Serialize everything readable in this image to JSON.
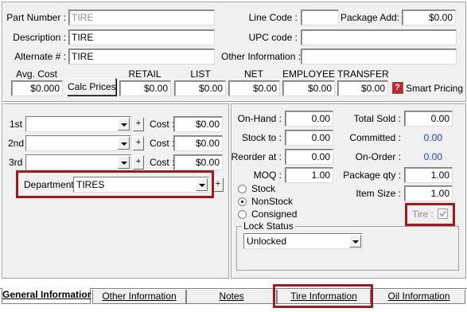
{
  "identity": {
    "part_number_label": "Part Number :",
    "part_number_value": "TIRE",
    "description_label": "Description :",
    "description_value": "TIRE",
    "alternate_label": "Alternate # :",
    "alternate_value": "TIRE",
    "line_code_label": "Line Code :",
    "line_code_value": "",
    "package_add_label": "Package Add:",
    "package_add_value": "$0.00",
    "upc_label": "UPC code :",
    "upc_value": "",
    "other_info_label": "Other Information :",
    "other_info_value": ""
  },
  "prices": {
    "avg_cost_label": "Avg. Cost",
    "avg_cost_value": "$0.000",
    "calc_prices_label": "Calc Prices",
    "retail_label": "RETAIL",
    "retail_value": "$0.00",
    "list_label": "LIST",
    "list_value": "$0.00",
    "net_label": "NET",
    "net_value": "$0.00",
    "employee_label": "EMPLOYEE",
    "employee_value": "$0.00",
    "transfer_label": "TRANSFER",
    "transfer_value": "$0.00",
    "smart_pricing_label": "Smart Pricing",
    "help_glyph": "?"
  },
  "vendors": {
    "rows": [
      {
        "label": "1st",
        "value": "",
        "cost_label": "Cost :",
        "cost_value": "$0.00"
      },
      {
        "label": "2nd",
        "value": "",
        "cost_label": "Cost :",
        "cost_value": "$0.00"
      },
      {
        "label": "3rd",
        "value": "",
        "cost_label": "Cost :",
        "cost_value": "$0.00"
      }
    ],
    "plus_glyph": "+",
    "department_label": "Department :",
    "department_value": "TIRES"
  },
  "stock": {
    "on_hand_label": "On-Hand :",
    "on_hand_value": "0.00",
    "stock_to_label": "Stock to :",
    "stock_to_value": "0.00",
    "reorder_label": "Reorder at :",
    "reorder_value": "0.00",
    "moq_label": "MOQ :",
    "moq_value": "1.00",
    "total_sold_label": "Total Sold :",
    "total_sold_value": "0.00",
    "committed_label": "Committed :",
    "committed_value": "0.00",
    "on_order_label": "On-Order :",
    "on_order_value": "0.00",
    "package_qty_label": "Package qty :",
    "package_qty_value": "1.00",
    "item_size_label": "Item Size :",
    "item_size_value": "1.00",
    "stock_type_options": [
      "Stock",
      "NonStock",
      "Consigned"
    ],
    "stock_type_selected": "NonStock",
    "tire_label": "Tire :",
    "tire_checked": true,
    "lock_status_label": "Lock Status",
    "lock_status_value": "Unlocked"
  },
  "tabs": [
    {
      "label": "General Informatior",
      "active": true
    },
    {
      "label": "Other Information",
      "active": false
    },
    {
      "label": "Notes",
      "active": false
    },
    {
      "label": "Tire Information",
      "active": false
    },
    {
      "label": "Oil Information",
      "active": false
    }
  ],
  "colors": {
    "highlight": "#9b1c1f",
    "accent_blue": "#1c3fb8",
    "help_red": "#c0282d"
  }
}
